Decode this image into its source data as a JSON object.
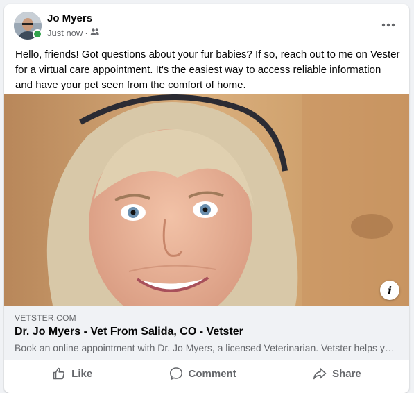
{
  "post": {
    "author": "Jo Myers",
    "timestamp": "Just now",
    "separator": "·",
    "audience_icon": "friends-icon",
    "text": "Hello, friends! Got questions about your fur babies?  If so, reach out to me on Vester for a virtual care appointment. It's the easiest way to access reliable information and have your pet seen from the comfort of home."
  },
  "link": {
    "domain": "VETSTER.COM",
    "title": "Dr. Jo Myers - Vet From Salida, CO - Vetster",
    "description": "Book an online appointment with Dr. Jo Myers, a licensed Veterinarian. Vetster helps you find and book trusted veterinarians for virtual care."
  },
  "actions": {
    "like": "Like",
    "comment": "Comment",
    "share": "Share"
  },
  "icons": {
    "more": "more-options-icon",
    "info": "i"
  },
  "colors": {
    "online": "#31a24c",
    "secondary_text": "#65676b",
    "primary_text": "#050505",
    "preview_bg": "#f0f2f5"
  }
}
